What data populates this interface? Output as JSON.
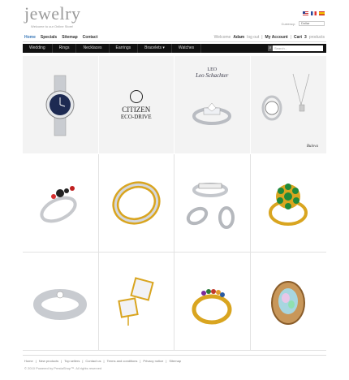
{
  "logo": {
    "word": "jewelry",
    "tagline": "Welcome to our Online Store!"
  },
  "flags": [
    "english-flag",
    "french-flag",
    "spanish-flag"
  ],
  "currency": {
    "label": "Currency:",
    "value": "Dollar"
  },
  "toplinks": [
    "Home",
    "Specials",
    "Sitemap",
    "Contact"
  ],
  "userbar": {
    "welcome": "Welcome",
    "name": "Adam",
    "login": "log out",
    "sep": "|",
    "account": "My Account",
    "cart": "Cart",
    "count": "3",
    "products": "products"
  },
  "nav": {
    "items": [
      "Wedding",
      "Rings",
      "Necklaces",
      "Earrings",
      "Bracelets ▾",
      "Watches"
    ],
    "search_placeholder": "Search..."
  },
  "brands": {
    "citizen": "CITIZEN",
    "eco": "ECO-DRIVE",
    "leo_top": "LEO",
    "leo_script": "Leo Schachter",
    "bulova": "Bulova"
  },
  "footer": {
    "links": [
      "Home",
      "|",
      "New products",
      "|",
      "Top sellers",
      "|",
      "Contact us",
      "|",
      "Terms and conditions",
      "|",
      "Privacy notice",
      "|",
      "Sitemap"
    ],
    "copyright": "© 2010 Powered by PrestaShop™. All rights reserved"
  },
  "colors": {
    "accent": "#3a78b8",
    "navbar": "#111111",
    "gold": "#d9a520",
    "silver": "#c8cbd0"
  }
}
